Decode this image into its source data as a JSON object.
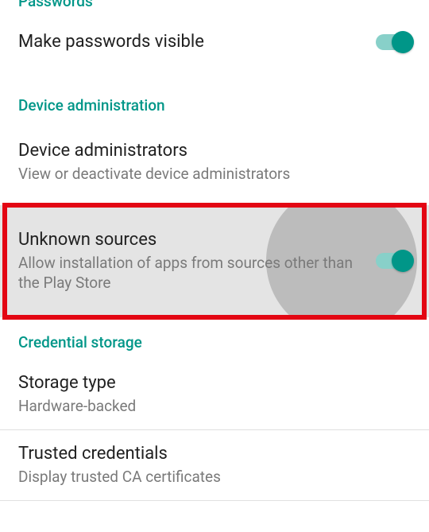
{
  "colors": {
    "accent": "#009688",
    "highlight": "#e30613"
  },
  "passwords": {
    "header": "Passwords",
    "make_visible": {
      "title": "Make passwords visible",
      "enabled": true
    }
  },
  "device_admin": {
    "header": "Device administration",
    "administrators": {
      "title": "Device administrators",
      "sub": "View or deactivate device administrators"
    },
    "unknown_sources": {
      "title": "Unknown sources",
      "sub": "Allow installation of apps from sources other than the Play Store",
      "enabled": true
    }
  },
  "credential_storage": {
    "header": "Credential storage",
    "storage_type": {
      "title": "Storage type",
      "sub": "Hardware-backed"
    },
    "trusted_credentials": {
      "title": "Trusted credentials",
      "sub": "Display trusted CA certificates"
    }
  }
}
